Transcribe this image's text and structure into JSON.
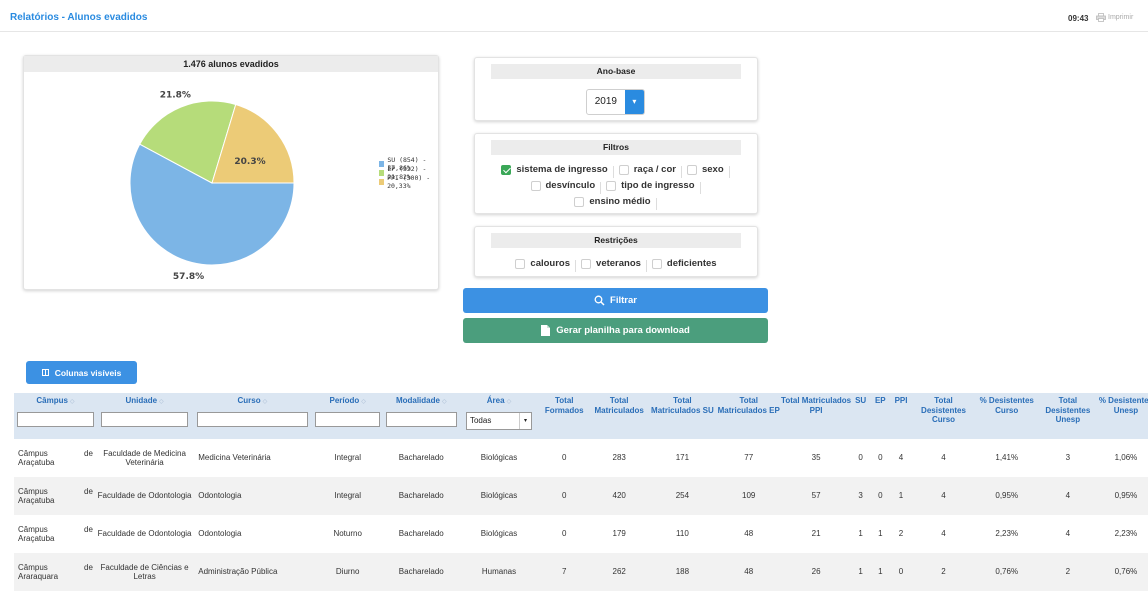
{
  "header": {
    "title": "Relatórios - Alunos evadidos",
    "time": "09:43",
    "print_label": "Imprimir"
  },
  "chart_panel": {
    "title": "1.476 alunos evadidos"
  },
  "chart_data": {
    "type": "pie",
    "title": "1.476 alunos evadidos",
    "slices": [
      {
        "label": "SU (854) - 57,86%",
        "value": 57.86,
        "pct_label": "57.8%",
        "color": "#7cb5e6"
      },
      {
        "label": "EP (322) - 21,82%",
        "value": 21.82,
        "pct_label": "21.8%",
        "color": "#b6dc7a"
      },
      {
        "label": "PPI (300) - 20,33%",
        "value": 20.33,
        "pct_label": "20.3%",
        "color": "#eccb77"
      }
    ],
    "legend_position": "right"
  },
  "anobase": {
    "title": "Ano-base",
    "selected": "2019"
  },
  "filtros": {
    "title": "Filtros",
    "items": [
      {
        "label": "sistema de ingresso",
        "checked": true
      },
      {
        "label": "raça / cor",
        "checked": false
      },
      {
        "label": "sexo",
        "checked": false
      },
      {
        "label": "desvínculo",
        "checked": false
      },
      {
        "label": "tipo de ingresso",
        "checked": false
      },
      {
        "label": "ensino médio",
        "checked": false
      }
    ]
  },
  "restricoes": {
    "title": "Restrições",
    "items": [
      {
        "label": "calouros",
        "checked": false
      },
      {
        "label": "veteranos",
        "checked": false
      },
      {
        "label": "deficientes",
        "checked": false
      }
    ]
  },
  "buttons": {
    "filtrar": "Filtrar",
    "gerar": "Gerar planilha para download",
    "colunas": "Colunas visíveis"
  },
  "table": {
    "columns": {
      "campus": "Câmpus",
      "unidade": "Unidade",
      "curso": "Curso",
      "periodo": "Período",
      "modalidade": "Modalidade",
      "area": "Área",
      "total_formados": "Total Formados",
      "total_matriculados": "Total Matriculados",
      "tm_su": "Total Matriculados SU",
      "tm_ep": "Total Matriculados EP",
      "tm_ppi": "Total Matriculados PPI",
      "su": "SU",
      "ep": "EP",
      "ppi": "PPI",
      "td_curso": "Total Desistentes Curso",
      "pd_curso": "% Desistentes Curso",
      "td_unesp": "Total Desistentes Unesp",
      "pd_unesp": "% Desistentes Unesp"
    },
    "area_filter": "Todas",
    "rows": [
      {
        "campus_a": "Câmpus",
        "campus_de": "de",
        "campus_b": "Araçatuba",
        "unidade": "Faculdade de Medicina Veterinária",
        "curso": "Medicina Veterinária",
        "periodo": "Integral",
        "modalidade": "Bacharelado",
        "area": "Biológicas",
        "total_formados": "0",
        "total_matriculados": "283",
        "tm_su": "171",
        "tm_ep": "77",
        "tm_ppi": "35",
        "su": "0",
        "ep": "0",
        "ppi": "4",
        "td_curso": "4",
        "pd_curso": "1,41%",
        "td_unesp": "3",
        "pd_unesp": "1,06%"
      },
      {
        "campus_a": "Câmpus",
        "campus_de": "de",
        "campus_b": "Araçatuba",
        "unidade": "Faculdade de Odontologia",
        "curso": "Odontologia",
        "periodo": "Integral",
        "modalidade": "Bacharelado",
        "area": "Biológicas",
        "total_formados": "0",
        "total_matriculados": "420",
        "tm_su": "254",
        "tm_ep": "109",
        "tm_ppi": "57",
        "su": "3",
        "ep": "0",
        "ppi": "1",
        "td_curso": "4",
        "pd_curso": "0,95%",
        "td_unesp": "4",
        "pd_unesp": "0,95%"
      },
      {
        "campus_a": "Câmpus",
        "campus_de": "de",
        "campus_b": "Araçatuba",
        "unidade": "Faculdade de Odontologia",
        "curso": "Odontologia",
        "periodo": "Noturno",
        "modalidade": "Bacharelado",
        "area": "Biológicas",
        "total_formados": "0",
        "total_matriculados": "179",
        "tm_su": "110",
        "tm_ep": "48",
        "tm_ppi": "21",
        "su": "1",
        "ep": "1",
        "ppi": "2",
        "td_curso": "4",
        "pd_curso": "2,23%",
        "td_unesp": "4",
        "pd_unesp": "2,23%"
      },
      {
        "campus_a": "Câmpus",
        "campus_de": "de",
        "campus_b": "Araraquara",
        "unidade": "Faculdade de Ciências e Letras",
        "curso": "Administração Pública",
        "periodo": "Diurno",
        "modalidade": "Bacharelado",
        "area": "Humanas",
        "total_formados": "7",
        "total_matriculados": "262",
        "tm_su": "188",
        "tm_ep": "48",
        "tm_ppi": "26",
        "su": "1",
        "ep": "1",
        "ppi": "0",
        "td_curso": "2",
        "pd_curso": "0,76%",
        "td_unesp": "2",
        "pd_unesp": "0,76%"
      }
    ]
  }
}
